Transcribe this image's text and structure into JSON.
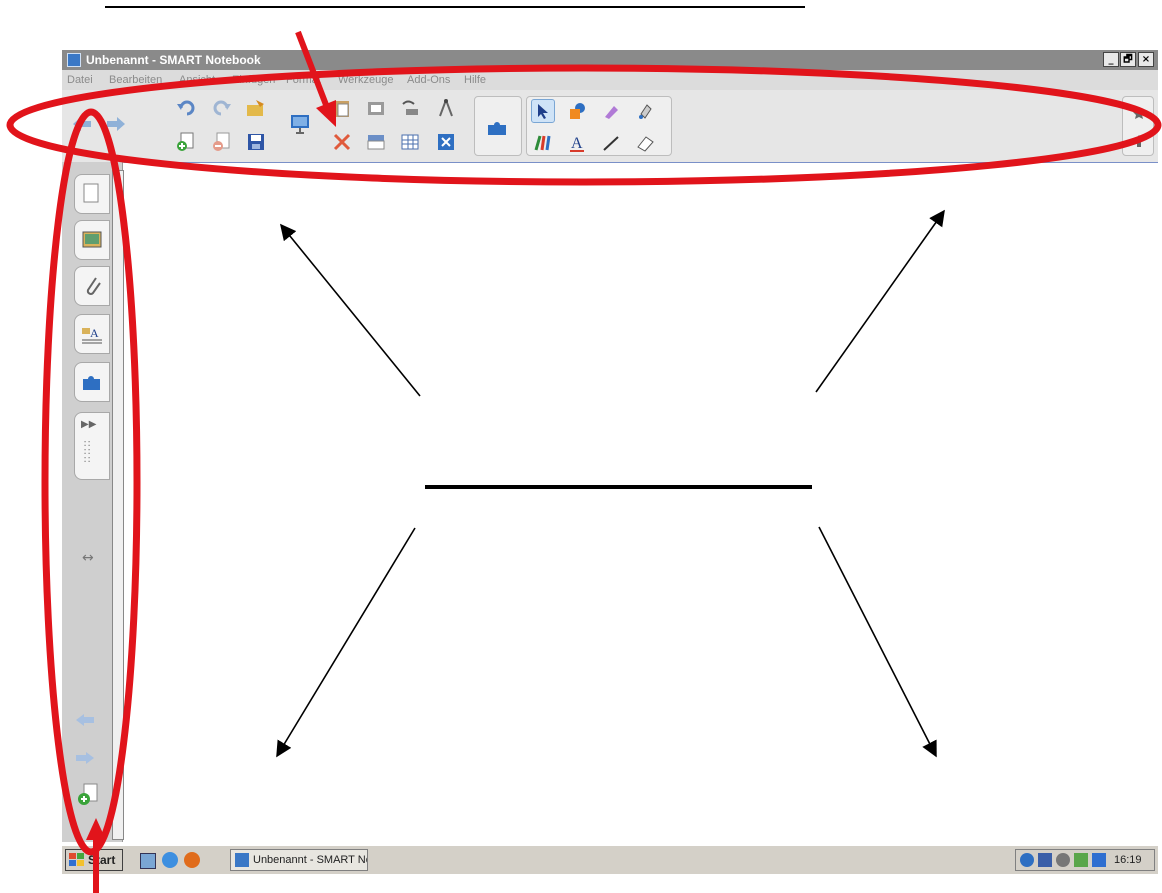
{
  "window": {
    "title": "Unbenannt - SMART Notebook",
    "controls": [
      "_",
      "🗗",
      "×"
    ]
  },
  "menu": {
    "items": [
      "Datei",
      "Bearbeiten",
      "Ansicht",
      "Einfügen",
      "Format",
      "Werkzeuge",
      "Add-Ons",
      "Hilfe"
    ]
  },
  "toolbar": {
    "buttons": [
      "back-arrow-icon",
      "forward-arrow-icon",
      "undo-icon",
      "redo-icon",
      "open-file-icon",
      "new-page-icon",
      "delete-page-icon",
      "save-icon",
      "presentation-icon",
      "paste-icon",
      "delete-icon",
      "screenshade-icon",
      "capture-icon",
      "document-camera-icon",
      "table-icon",
      "measurement-tools-icon",
      "full-screen-icon",
      "addons-icon",
      "select-icon",
      "shapes-icon",
      "magic-pen-icon",
      "fill-icon",
      "pens-icon",
      "text-icon",
      "line-icon",
      "eraser-icon",
      "pin-icon",
      "move-toolbar-icon"
    ]
  },
  "sidebar": {
    "tabs": [
      "page-sorter-icon",
      "gallery-icon",
      "attachments-icon",
      "properties-icon",
      "addons-icon"
    ],
    "resize_icon": "↔"
  },
  "taskbar": {
    "start_label": "Start",
    "task_label": "Unbenannt - SMART Not...",
    "clock": "16:19"
  },
  "colors": {
    "annotation_red": "#e1141b",
    "titlebar": "#8a8a8a",
    "accent_blue": "#2e6fc2"
  }
}
